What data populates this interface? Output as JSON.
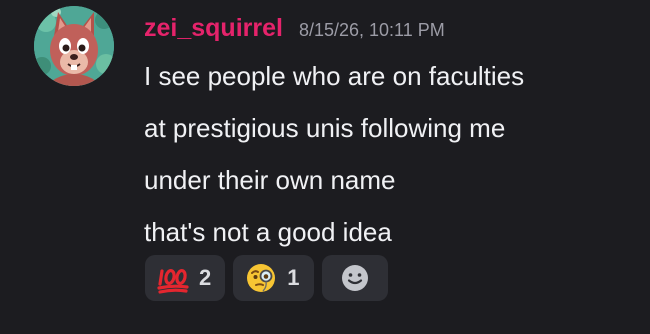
{
  "message": {
    "author": "zei_squirrel",
    "timestamp": "8/15/26, 10:11 PM",
    "lines": [
      "I see people who are on faculties",
      "at prestigious unis following me",
      "under their own name",
      "that's not a good idea"
    ],
    "author_color": "#e5236b"
  },
  "reactions": [
    {
      "emoji": "hundred-points-emoji",
      "count": "2"
    },
    {
      "emoji": "face-with-monocle-emoji",
      "count": "1"
    }
  ],
  "add_reaction_icon": "add-reaction-smiley-icon"
}
